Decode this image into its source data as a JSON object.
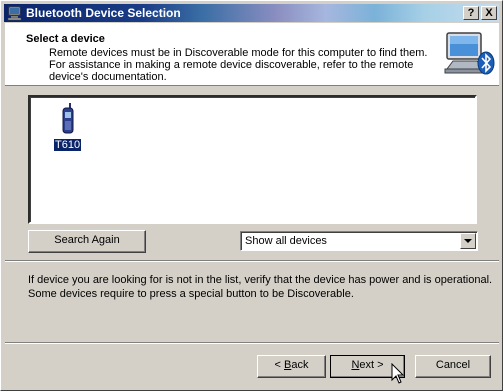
{
  "window": {
    "title": "Bluetooth Device Selection",
    "help_button": "?",
    "close_button": "X"
  },
  "header": {
    "title": "Select a device",
    "description_lines": [
      "Remote devices must be in Discoverable mode for this computer to find them.",
      "For assistance in making a remote device discoverable, refer to the remote",
      "device's documentation."
    ],
    "logo_icon": "bluetooth-computer-icon"
  },
  "device_list": {
    "items": [
      {
        "label": "T610",
        "icon": "mobile-phone-icon",
        "selected": true
      }
    ]
  },
  "controls": {
    "search_again_label": "Search Again",
    "filter_value": "Show all devices"
  },
  "info_lines": [
    "If device you are looking for is not in the list, verify that the device has power and is operational.",
    "Some devices require to press a special button to be Discoverable."
  ],
  "buttons": {
    "back": {
      "prefix": "< ",
      "accel": "B",
      "rest": "ack"
    },
    "next": {
      "accel": "N",
      "rest": "ext",
      "suffix": " >"
    },
    "cancel": "Cancel"
  },
  "colors": {
    "title_bar": "#0a246a",
    "window_face": "#d4d0c8",
    "selection": "#0a246a"
  }
}
